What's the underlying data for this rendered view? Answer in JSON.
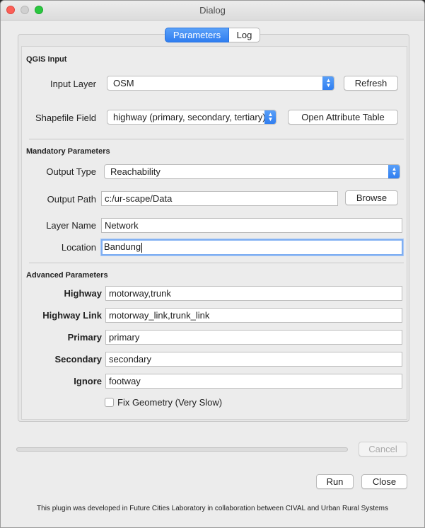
{
  "window": {
    "title": "Dialog"
  },
  "tabs": [
    {
      "label": "Parameters"
    },
    {
      "label": "Log"
    }
  ],
  "qgis_input": {
    "section_title": "QGIS Input",
    "input_layer_label": "Input Layer",
    "input_layer_value": "OSM",
    "refresh_label": "Refresh",
    "shapefile_field_label": "Shapefile Field",
    "shapefile_field_value": "highway (primary, secondary, tertiary)",
    "open_attribute_table_label": "Open Attribute Table"
  },
  "mandatory": {
    "section_title": "Mandatory Parameters",
    "output_type_label": "Output Type",
    "output_type_value": "Reachability",
    "output_path_label": "Output Path",
    "output_path_value": "c:/ur-scape/Data",
    "browse_label": "Browse",
    "layer_name_label": "Layer Name",
    "layer_name_value": "Network",
    "location_label": "Location",
    "location_value": "Bandung"
  },
  "advanced": {
    "section_title": "Advanced Parameters",
    "highway_label": "Highway",
    "highway_value": "motorway,trunk",
    "highway_link_label": "Highway Link",
    "highway_link_value": "motorway_link,trunk_link",
    "primary_label": "Primary",
    "primary_value": "primary",
    "secondary_label": "Secondary",
    "secondary_value": "secondary",
    "ignore_label": "Ignore",
    "ignore_value": "footway",
    "fix_geometry_label": "Fix Geometry (Very Slow)"
  },
  "actions": {
    "cancel_label": "Cancel",
    "run_label": "Run",
    "close_label": "Close"
  },
  "footer": {
    "text": "This plugin was developed in Future Cities Laboratory in collaboration between CIVAL and Urban Rural Systems"
  },
  "colors": {
    "accent": "#2f7df0",
    "focus_ring": "#7eaef2"
  }
}
